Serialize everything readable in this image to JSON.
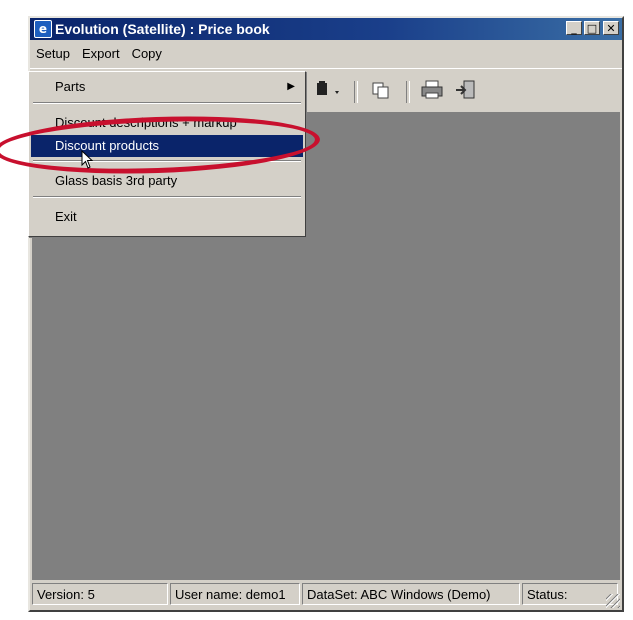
{
  "window": {
    "title": "Evolution (Satellite) : Price book",
    "controls": {
      "minimize": "_",
      "maximize": "□",
      "close": "✕"
    }
  },
  "menubar": {
    "items": [
      "Setup",
      "Export",
      "Copy"
    ]
  },
  "toolbar": {
    "icons": [
      "toolbar-dropdown-icon",
      "copy-icon",
      "print-icon",
      "exit-icon"
    ]
  },
  "setup_menu": {
    "items": [
      {
        "label": "Parts",
        "has_submenu": true
      },
      {
        "label": "Discount descriptions + markup"
      },
      {
        "label": "Discount products",
        "selected": true
      },
      {
        "label": "Glass basis 3rd party"
      },
      {
        "label": "Exit"
      }
    ]
  },
  "statusbar": {
    "version": "Version: 5",
    "user": "User name: demo1",
    "dataset": "DataSet: ABC Windows (Demo)",
    "status": "Status:"
  },
  "colors": {
    "highlight": "#0a246a",
    "annotation": "#c8102e",
    "client": "#808080"
  }
}
